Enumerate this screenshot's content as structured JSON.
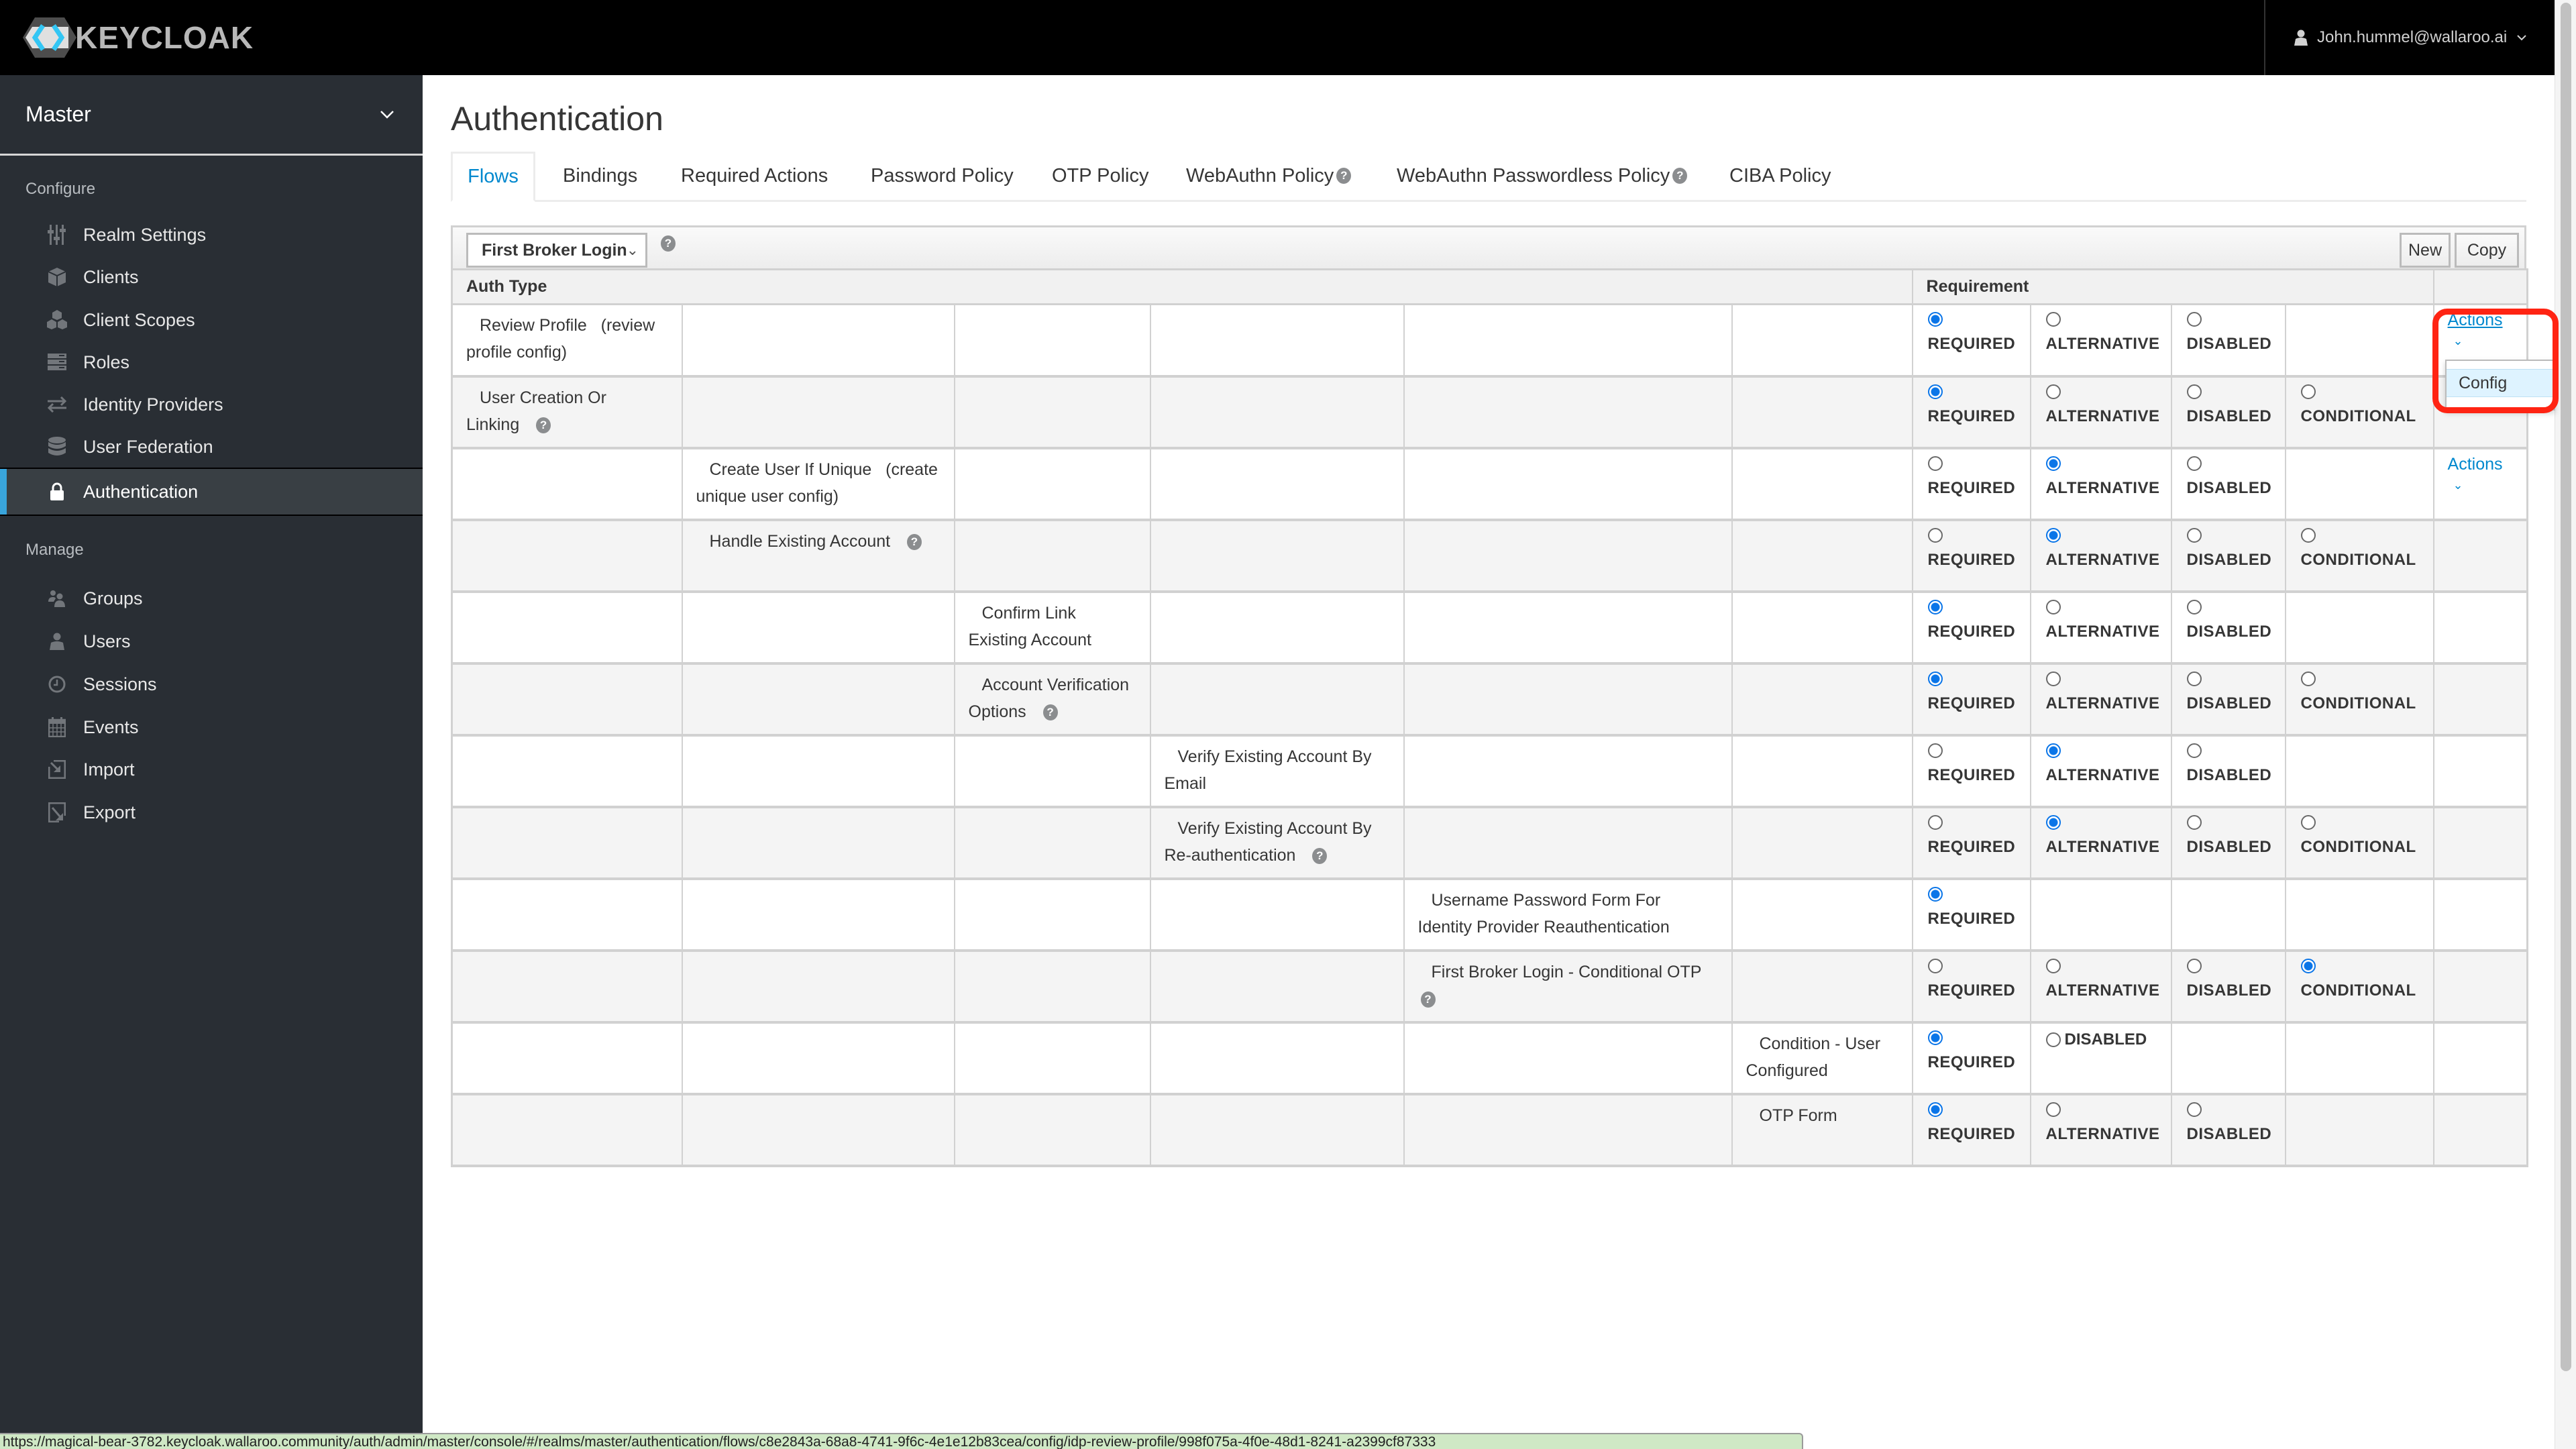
{
  "navbar": {
    "brand": "KEYCLOAK",
    "user": "John.hummel@wallaroo.ai"
  },
  "sidebar": {
    "realm": "Master",
    "configure_label": "Configure",
    "configure_items": [
      {
        "label": "Realm Settings",
        "icon": "sliders-icon"
      },
      {
        "label": "Clients",
        "icon": "cube-icon"
      },
      {
        "label": "Client Scopes",
        "icon": "cubes-icon"
      },
      {
        "label": "Roles",
        "icon": "server-icon"
      },
      {
        "label": "Identity Providers",
        "icon": "exchange-icon"
      },
      {
        "label": "User Federation",
        "icon": "database-icon"
      },
      {
        "label": "Authentication",
        "icon": "lock-icon",
        "active": true
      }
    ],
    "manage_label": "Manage",
    "manage_items": [
      {
        "label": "Groups",
        "icon": "users-icon"
      },
      {
        "label": "Users",
        "icon": "user-icon"
      },
      {
        "label": "Sessions",
        "icon": "clock-icon"
      },
      {
        "label": "Events",
        "icon": "calendar-icon"
      },
      {
        "label": "Import",
        "icon": "import-icon"
      },
      {
        "label": "Export",
        "icon": "export-icon"
      }
    ]
  },
  "page": {
    "title": "Authentication",
    "tabs": [
      {
        "label": "Flows",
        "active": true
      },
      {
        "label": "Bindings"
      },
      {
        "label": "Required Actions"
      },
      {
        "label": "Password Policy"
      },
      {
        "label": "OTP Policy"
      },
      {
        "label": "WebAuthn Policy",
        "help": true
      },
      {
        "label": "WebAuthn Passwordless Policy",
        "help": true
      },
      {
        "label": "CIBA Policy"
      }
    ]
  },
  "toolbar": {
    "selected_flow": "First Broker Login",
    "new_label": "New",
    "copy_label": "Copy"
  },
  "table": {
    "col_auth_type": "Auth Type",
    "col_requirement": "Requirement",
    "help_glyph": "?",
    "rows": [
      {
        "name": "Review Profile",
        "suffix": "(review profile config)",
        "level": 0,
        "help": false,
        "options": [
          "REQUIRED",
          "ALTERNATIVE",
          "DISABLED"
        ],
        "selected": "REQUIRED",
        "actions": "Actions"
      },
      {
        "name": "User Creation Or Linking",
        "level": 0,
        "help": true,
        "options": [
          "REQUIRED",
          "ALTERNATIVE",
          "DISABLED",
          "CONDITIONAL"
        ],
        "selected": "REQUIRED"
      },
      {
        "name": "Create User If Unique",
        "suffix": "(create unique user config)",
        "level": 1,
        "help": false,
        "options": [
          "REQUIRED",
          "ALTERNATIVE",
          "DISABLED"
        ],
        "selected": "ALTERNATIVE",
        "actions": "Actions"
      },
      {
        "name": "Handle Existing Account",
        "level": 1,
        "help": true,
        "options": [
          "REQUIRED",
          "ALTERNATIVE",
          "DISABLED",
          "CONDITIONAL"
        ],
        "selected": "ALTERNATIVE"
      },
      {
        "name": "Confirm Link Existing Account",
        "level": 2,
        "help": false,
        "options": [
          "REQUIRED",
          "ALTERNATIVE",
          "DISABLED"
        ],
        "selected": "REQUIRED"
      },
      {
        "name": "Account Verification Options",
        "level": 2,
        "help": true,
        "options": [
          "REQUIRED",
          "ALTERNATIVE",
          "DISABLED",
          "CONDITIONAL"
        ],
        "selected": "REQUIRED"
      },
      {
        "name": "Verify Existing Account By Email",
        "level": 3,
        "help": false,
        "options": [
          "REQUIRED",
          "ALTERNATIVE",
          "DISABLED"
        ],
        "selected": "ALTERNATIVE"
      },
      {
        "name": "Verify Existing Account By Re-authentication",
        "level": 3,
        "help": true,
        "options": [
          "REQUIRED",
          "ALTERNATIVE",
          "DISABLED",
          "CONDITIONAL"
        ],
        "selected": "ALTERNATIVE"
      },
      {
        "name": "Username Password Form For Identity Provider Reauthentication",
        "level": 4,
        "help": false,
        "options": [
          "REQUIRED"
        ],
        "selected": "REQUIRED"
      },
      {
        "name": "First Broker Login - Conditional OTP",
        "level": 4,
        "help": true,
        "options": [
          "REQUIRED",
          "ALTERNATIVE",
          "DISABLED",
          "CONDITIONAL"
        ],
        "selected": "CONDITIONAL"
      },
      {
        "name": "Condition - User Configured",
        "level": 5,
        "help": false,
        "options": [
          "REQUIRED",
          "DISABLED"
        ],
        "selected": "REQUIRED",
        "inline_second": true
      },
      {
        "name": "OTP Form",
        "level": 5,
        "help": false,
        "options": [
          "REQUIRED",
          "ALTERNATIVE",
          "DISABLED"
        ],
        "selected": "REQUIRED"
      }
    ]
  },
  "dropdown": {
    "items": [
      "Config"
    ]
  },
  "status_bar": {
    "url": "https://magical-bear-3782.keycloak.wallaroo.community/auth/admin/master/console/#/realms/master/authentication/flows/c8e2843a-68a8-4741-9f6c-4e1e12b83cea/config/idp-review-profile/998f075a-4f0e-48d1-8241-a2399cf87333"
  },
  "colors": {
    "accent": "#0088ce",
    "radio_selected": "#0a75e8",
    "sidebar_bg": "#292e34",
    "active_indicator": "#39a5dc",
    "highlight": "#ff2413"
  }
}
